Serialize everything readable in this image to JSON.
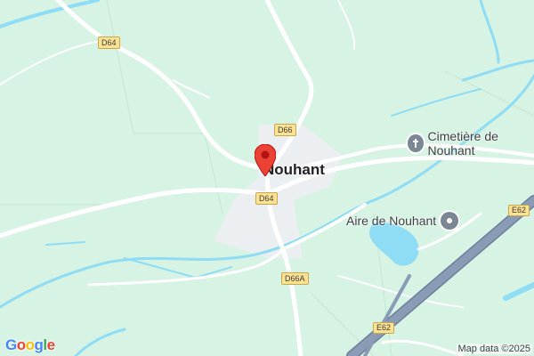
{
  "map": {
    "place_name": "Nouhant",
    "poi": [
      {
        "name": "Cimetière de Nouhant",
        "icon": "cemetery-icon"
      },
      {
        "name": "Aire de Nouhant",
        "icon": "rest-area-icon"
      }
    ],
    "road_labels": [
      "D64",
      "D66",
      "D64",
      "D66A"
    ],
    "highway_labels": [
      "E62",
      "E62"
    ],
    "logo": "Google",
    "attribution": "Map data ©2025",
    "colors": {
      "land": "#d7f3e3",
      "water": "#8fdcf5",
      "settlement": "#eceff1",
      "highway": "#8a9bb5",
      "road": "#ffffff",
      "pin": "#ea4335"
    }
  }
}
